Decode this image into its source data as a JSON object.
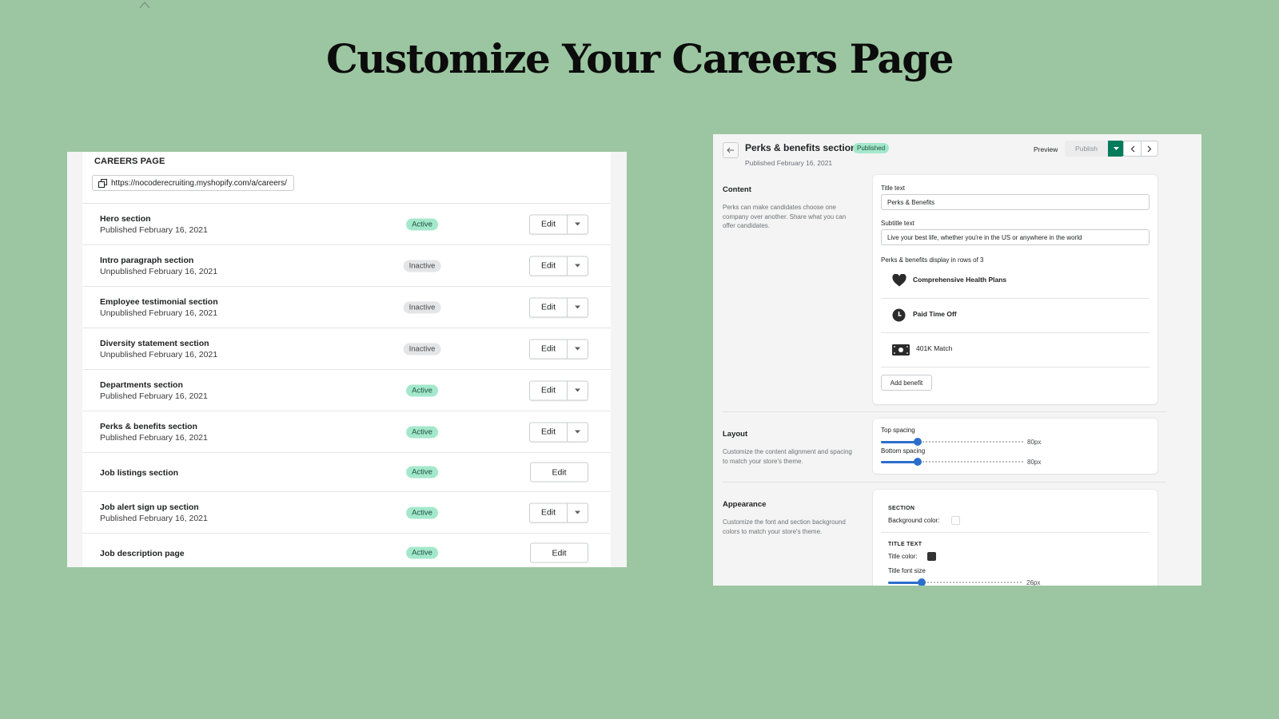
{
  "title": "Customize Your Careers Page",
  "careers_page": {
    "heading": "CAREERS PAGE",
    "url": "https://nocoderecruiting.myshopify.com/a/careers/",
    "edit_label": "Edit",
    "sections": [
      {
        "name": "Hero section",
        "status_text": "Published February 16, 2021",
        "badge": "Active",
        "has_dropdown": true
      },
      {
        "name": "Intro paragraph section",
        "status_text": "Unpublished February 16, 2021",
        "badge": "Inactive",
        "has_dropdown": true
      },
      {
        "name": "Employee testimonial section",
        "status_text": "Unpublished February 16, 2021",
        "badge": "Inactive",
        "has_dropdown": true
      },
      {
        "name": "Diversity statement section",
        "status_text": "Unpublished February 16, 2021",
        "badge": "Inactive",
        "has_dropdown": true
      },
      {
        "name": "Departments section",
        "status_text": "Published February 16, 2021",
        "badge": "Active",
        "has_dropdown": true
      },
      {
        "name": "Perks & benefits section",
        "status_text": "Published February 16, 2021",
        "badge": "Active",
        "has_dropdown": true
      },
      {
        "name": "Job listings section",
        "status_text": "",
        "badge": "Active",
        "has_dropdown": false
      },
      {
        "name": "Job alert sign up section",
        "status_text": "Published February 16, 2021",
        "badge": "Active",
        "has_dropdown": true
      },
      {
        "name": "Job description page",
        "status_text": "",
        "badge": "Active",
        "has_dropdown": false
      }
    ]
  },
  "editor": {
    "title": "Perks & benefits section",
    "badge": "Published",
    "subtitle": "Published February 16, 2021",
    "preview_label": "Preview",
    "publish_label": "Publish",
    "content": {
      "heading": "Content",
      "description": "Perks can make candidates choose one company over another. Share what you can offer candidates.",
      "title_label": "Title text",
      "title_value": "Perks & Benefits",
      "subtitle_label": "Subtitle text",
      "subtitle_value": "Live your best life, whether you're in the US or anywhere in the world",
      "perks_label": "Perks & benefits display in rows of 3",
      "perks": [
        {
          "icon": "heart-icon",
          "label": "Comprehensive Health Plans"
        },
        {
          "icon": "clock-icon",
          "label": "Paid Time Off"
        },
        {
          "icon": "money-icon",
          "label": "401K Match"
        }
      ],
      "add_benefit_label": "Add benefit"
    },
    "layout": {
      "heading": "Layout",
      "description": "Customize the content alignment and spacing to match your store's theme.",
      "top_spacing_label": "Top spacing",
      "top_spacing_value": "80px",
      "top_spacing_fraction": 0.26,
      "bottom_spacing_label": "Bottom spacing",
      "bottom_spacing_value": "80px",
      "bottom_spacing_fraction": 0.26
    },
    "appearance": {
      "heading": "Appearance",
      "description": "Customize the font and section background colors to match your store's theme.",
      "section_caption": "SECTION",
      "bg_color_label": "Background color:",
      "bg_color": "#ffffff",
      "title_caption": "TITLE TEXT",
      "title_color_label": "Title color:",
      "title_color": "#333333",
      "title_font_size_label": "Title font size",
      "title_font_size_value": "26px",
      "title_font_size_fraction": 0.25
    }
  },
  "colors": {
    "background": "#9bc6a1",
    "active_badge": "#a4e8cc",
    "inactive_badge": "#e4e5e7",
    "primary_green": "#007b5c",
    "slider_blue": "#2c6ecb"
  }
}
